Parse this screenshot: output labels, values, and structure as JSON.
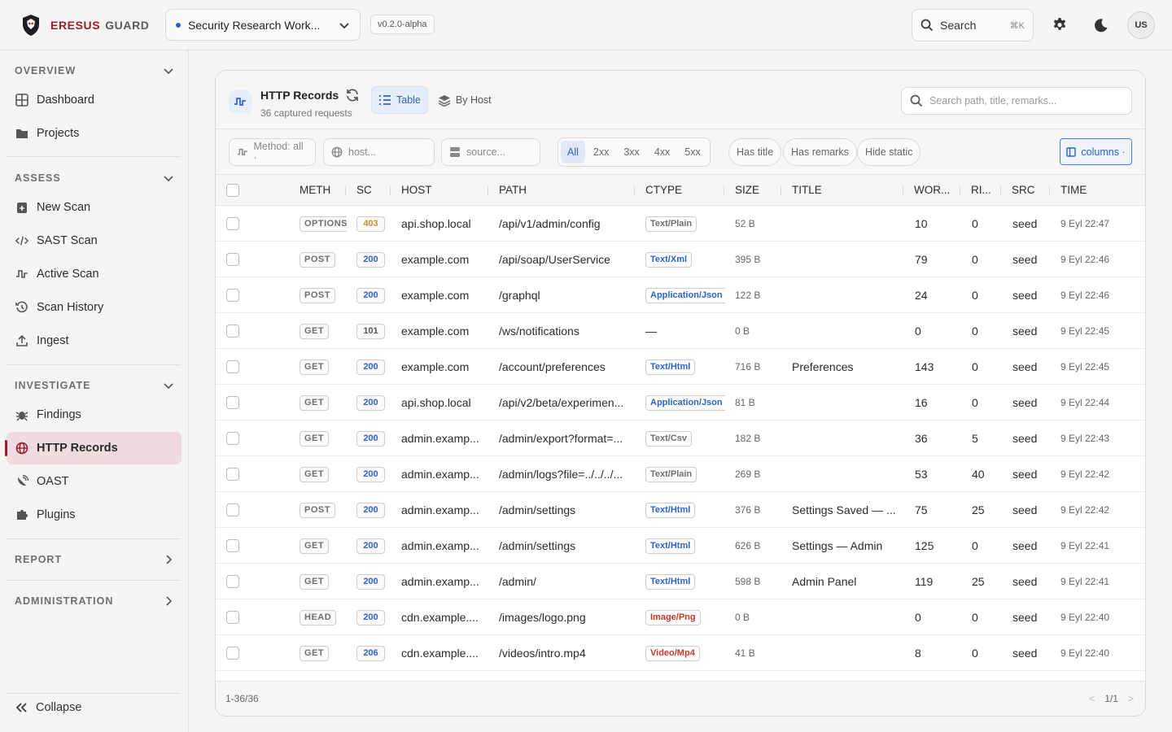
{
  "header": {
    "brand_primary": "ERESUS",
    "brand_secondary": "GUARD",
    "workspace": "Security Research Work...",
    "version": "v0.2.0-alpha",
    "search_label": "Search",
    "search_shortcut": "⌘K",
    "avatar_initials": "US"
  },
  "sidebar": {
    "sections": {
      "overview": "OVERVIEW",
      "assess": "ASSESS",
      "investigate": "INVESTIGATE",
      "report": "REPORT",
      "administration": "ADMINISTRATION"
    },
    "items": {
      "dashboard": "Dashboard",
      "projects": "Projects",
      "new_scan": "New Scan",
      "sast_scan": "SAST Scan",
      "active_scan": "Active Scan",
      "scan_history": "Scan History",
      "ingest": "Ingest",
      "findings": "Findings",
      "http_records": "HTTP Records",
      "oast": "OAST",
      "plugins": "Plugins"
    },
    "collapse": "Collapse"
  },
  "panel": {
    "title": "HTTP Records",
    "subtitle": "36 captured requests",
    "tab_table": "Table",
    "tab_by_host": "By Host",
    "search_placeholder": "Search path, title, remarks...",
    "filters": {
      "method": "Method: all ·",
      "host_placeholder": "host...",
      "source_placeholder": "source...",
      "status_all": "All",
      "status_2xx": "2xx",
      "status_3xx": "3xx",
      "status_4xx": "4xx",
      "status_5xx": "5xx",
      "has_title": "Has title",
      "has_remarks": "Has remarks",
      "hide_static": "Hide static",
      "columns": "columns ·"
    },
    "columns": {
      "method": "METH",
      "status": "SC",
      "host": "HOST",
      "path": "PATH",
      "ctype": "CTYPE",
      "size": "SIZE",
      "title": "TITLE",
      "words": "WOR...",
      "risk": "RI...",
      "source": "SRC",
      "time": "TIME"
    },
    "rows": [
      {
        "method": "OPTIONS",
        "status": "403",
        "host": "api.shop.local",
        "path": "/api/v1/admin/config",
        "ctype": "Text/Plain",
        "ctype_color": "#6e6d72",
        "size": "52 B",
        "title": "",
        "words": "10",
        "risk": "0",
        "source": "seed",
        "time": "9 Eyl 22:47"
      },
      {
        "method": "POST",
        "status": "200",
        "host": "example.com",
        "path": "/api/soap/UserService",
        "ctype": "Text/Xml",
        "ctype_color": "#2d63c8",
        "size": "395 B",
        "title": "",
        "words": "79",
        "risk": "0",
        "source": "seed",
        "time": "9 Eyl 22:46"
      },
      {
        "method": "POST",
        "status": "200",
        "host": "example.com",
        "path": "/graphql",
        "ctype": "Application/Json",
        "ctype_color": "#2d63c8",
        "size": "122 B",
        "title": "",
        "words": "24",
        "risk": "0",
        "source": "seed",
        "time": "9 Eyl 22:46"
      },
      {
        "method": "GET",
        "status": "101",
        "host": "example.com",
        "path": "/ws/notifications",
        "ctype": "—",
        "ctype_color": "",
        "size": "0 B",
        "title": "",
        "words": "0",
        "risk": "0",
        "source": "seed",
        "time": "9 Eyl 22:45"
      },
      {
        "method": "GET",
        "status": "200",
        "host": "example.com",
        "path": "/account/preferences",
        "ctype": "Text/Html",
        "ctype_color": "#2d63c8",
        "size": "716 B",
        "title": "Preferences",
        "words": "143",
        "risk": "0",
        "source": "seed",
        "time": "9 Eyl 22:45"
      },
      {
        "method": "GET",
        "status": "200",
        "host": "api.shop.local",
        "path": "/api/v2/beta/experimen...",
        "ctype": "Application/Json",
        "ctype_color": "#2d63c8",
        "size": "81 B",
        "title": "",
        "words": "16",
        "risk": "0",
        "source": "seed",
        "time": "9 Eyl 22:44"
      },
      {
        "method": "GET",
        "status": "200",
        "host": "admin.examp...",
        "path": "/admin/export?format=...",
        "ctype": "Text/Csv",
        "ctype_color": "#6e6d72",
        "size": "182 B",
        "title": "",
        "words": "36",
        "risk": "5",
        "source": "seed",
        "time": "9 Eyl 22:43"
      },
      {
        "method": "GET",
        "status": "200",
        "host": "admin.examp...",
        "path": "/admin/logs?file=../../../...",
        "ctype": "Text/Plain",
        "ctype_color": "#6e6d72",
        "size": "269 B",
        "title": "",
        "words": "53",
        "risk": "40",
        "source": "seed",
        "time": "9 Eyl 22:42"
      },
      {
        "method": "POST",
        "status": "200",
        "host": "admin.examp...",
        "path": "/admin/settings",
        "ctype": "Text/Html",
        "ctype_color": "#2d63c8",
        "size": "376 B",
        "title": "Settings Saved — ...",
        "words": "75",
        "risk": "25",
        "source": "seed",
        "time": "9 Eyl 22:42"
      },
      {
        "method": "GET",
        "status": "200",
        "host": "admin.examp...",
        "path": "/admin/settings",
        "ctype": "Text/Html",
        "ctype_color": "#2d63c8",
        "size": "626 B",
        "title": "Settings — Admin",
        "words": "125",
        "risk": "0",
        "source": "seed",
        "time": "9 Eyl 22:41"
      },
      {
        "method": "GET",
        "status": "200",
        "host": "admin.examp...",
        "path": "/admin/",
        "ctype": "Text/Html",
        "ctype_color": "#2d63c8",
        "size": "598 B",
        "title": "Admin Panel",
        "words": "119",
        "risk": "25",
        "source": "seed",
        "time": "9 Eyl 22:41"
      },
      {
        "method": "HEAD",
        "status": "200",
        "host": "cdn.example....",
        "path": "/images/logo.png",
        "ctype": "Image/Png",
        "ctype_color": "#c0392b",
        "size": "0 B",
        "title": "",
        "words": "0",
        "risk": "0",
        "source": "seed",
        "time": "9 Eyl 22:40"
      },
      {
        "method": "GET",
        "status": "206",
        "host": "cdn.example....",
        "path": "/videos/intro.mp4",
        "ctype": "Video/Mp4",
        "ctype_color": "#c0392b",
        "size": "41 B",
        "title": "",
        "words": "8",
        "risk": "0",
        "source": "seed",
        "time": "9 Eyl 22:40"
      }
    ],
    "footer": {
      "range": "1-36/36",
      "prev": "<",
      "page": "1/1",
      "next": ">"
    }
  },
  "colors": {
    "brand": "#9b1c2c",
    "accent": "#2d63c8",
    "status_2xx": "#2d63c8",
    "status_4xx": "#d08a2c",
    "status_1xx": "#555555"
  }
}
